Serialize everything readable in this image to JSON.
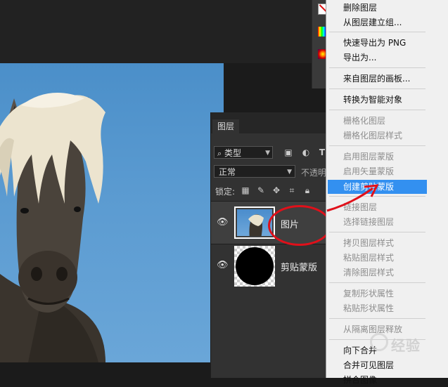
{
  "layers_panel": {
    "tab_label": "图层",
    "filter_kind": "类型",
    "blend_mode": "正常",
    "opacity_label": "不透明",
    "lock_label": "锁定:",
    "layers": [
      {
        "name": "图片",
        "selected": true
      },
      {
        "name": "剪贴蒙版",
        "selected": false
      }
    ]
  },
  "context_menu": {
    "items": [
      {
        "label": "删除图层",
        "enabled": true
      },
      {
        "label": "从图层建立组...",
        "enabled": true
      },
      {
        "label": "快速导出为 PNG",
        "enabled": true
      },
      {
        "label": "导出为...",
        "enabled": true
      },
      {
        "label": "来自图层的画板...",
        "enabled": true
      },
      {
        "label": "转换为智能对象",
        "enabled": true
      },
      {
        "label": "栅格化图层",
        "enabled": false
      },
      {
        "label": "栅格化图层样式",
        "enabled": false
      },
      {
        "label": "启用图层蒙版",
        "enabled": false
      },
      {
        "label": "启用矢量蒙版",
        "enabled": false
      },
      {
        "label": "创建剪贴蒙版",
        "enabled": true,
        "highlighted": true
      },
      {
        "label": "链接图层",
        "enabled": false
      },
      {
        "label": "选择链接图层",
        "enabled": false
      },
      {
        "label": "拷贝图层样式",
        "enabled": false
      },
      {
        "label": "粘贴图层样式",
        "enabled": false
      },
      {
        "label": "清除图层样式",
        "enabled": false
      },
      {
        "label": "复制形状属性",
        "enabled": false
      },
      {
        "label": "粘贴形状属性",
        "enabled": false
      },
      {
        "label": "从隔离图层释放",
        "enabled": false
      },
      {
        "label": "向下合并",
        "enabled": true
      },
      {
        "label": "合并可见图层",
        "enabled": true
      },
      {
        "label": "拼合图像",
        "enabled": true
      }
    ]
  },
  "watermark": "经验",
  "colors": {
    "highlight": "#3390f0",
    "annotation_red": "#e0101a",
    "sky": "#5b9bd1"
  }
}
